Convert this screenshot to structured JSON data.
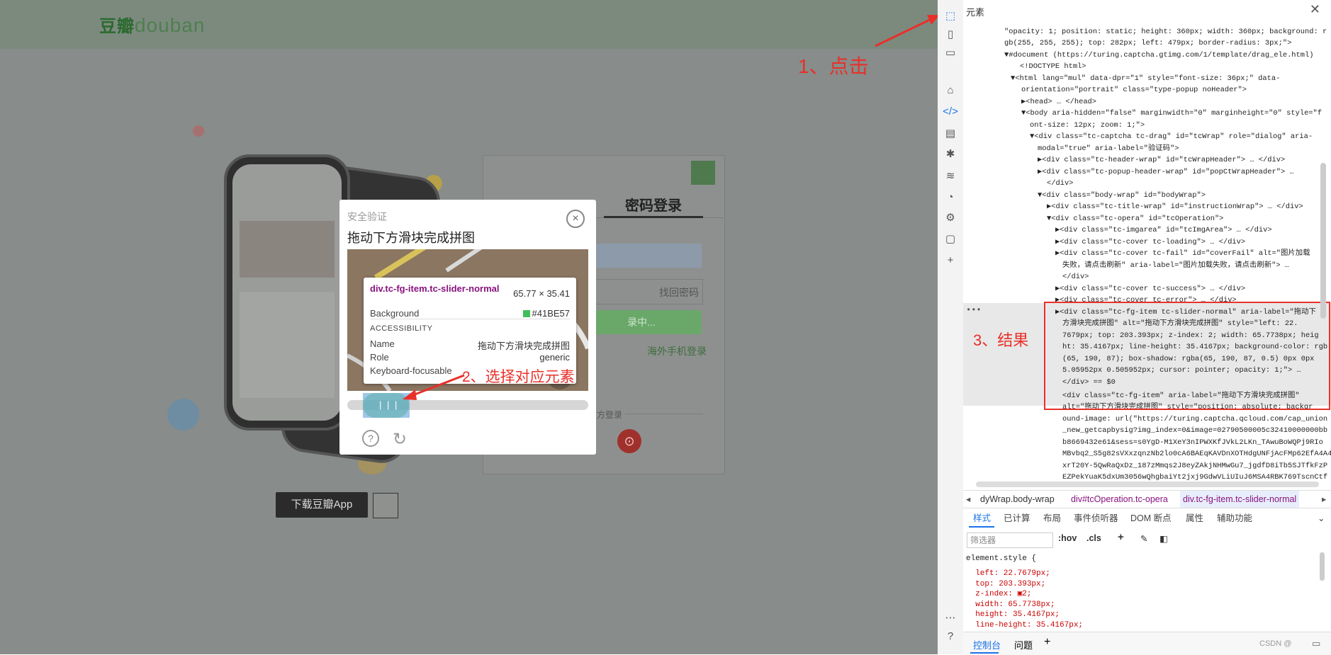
{
  "site": {
    "logo_cn": "豆瓣",
    "logo_en": "douban"
  },
  "login": {
    "tab_password": "密码登录",
    "forgot": "找回密码",
    "login_button": "录中...",
    "overseas": "海外手机登录",
    "third_party": "方登录",
    "download_app": "下载豆瓣App"
  },
  "captcha": {
    "title": "安全验证",
    "instruction": "拖动下方滑块完成拼图",
    "grip": "| | |"
  },
  "tooltip": {
    "selector": "div.tc-fg-item.tc-slider-normal",
    "size": "65.77 × 35.41",
    "background_label": "Background",
    "background_value": "#41BE57",
    "accessibility_heading": "ACCESSIBILITY",
    "name_label": "Name",
    "name_value": "拖动下方滑块完成拼图",
    "role_label": "Role",
    "role_value": "generic",
    "focusable_label": "Keyboard-focusable"
  },
  "annotations": {
    "step1": "1、点击",
    "step2": "2、选择对应元素",
    "step3": "3、结果"
  },
  "devtools": {
    "panel_title": "元素",
    "dom_lines": [
      "\"opacity: 1; position: static; height: 360px; width: 360px; background: r",
      "gb(255, 255, 255); top: 282px; left: 479px; border-radius: 3px;\">",
      "▼#document (https://turing.captcha.gtimg.com/1/template/drag_ele.html)",
      "<!DOCTYPE html>",
      "▼<html lang=\"mul\" data-dpr=\"1\" style=\"font-size: 36px;\" data-",
      "orientation=\"portrait\" class=\"type-popup noHeader\">",
      "▶<head> … </head>",
      "▼<body aria-hidden=\"false\" marginwidth=\"0\" marginheight=\"0\" style=\"f",
      "ont-size: 12px; zoom: 1;\">",
      "▼<div class=\"tc-captcha tc-drag\" id=\"tcWrap\" role=\"dialog\" aria-",
      "modal=\"true\" aria-label=\"验证码\">",
      "▶<div class=\"tc-header-wrap\" id=\"tcWrapHeader\"> … </div>",
      "▶<div class=\"tc-popup-header-wrap\" id=\"popCtWrapHeader\"> …",
      "</div>",
      "▼<div class=\"body-wrap\" id=\"bodyWrap\">",
      "▶<div class=\"tc-title-wrap\" id=\"instructionWrap\"> … </div>",
      "▼<div class=\"tc-opera\" id=\"tcOperation\">",
      "▶<div class=\"tc-imgarea\" id=\"tcImgArea\"> … </div>",
      "▶<div class=\"tc-cover tc-loading\"> … </div>",
      "▶<div class=\"tc-cover tc-fail\" id=\"coverFail\" alt=\"图片加载",
      "失败，请点击刷新\" aria-label=\"图片加载失败，请点击刷新\"> …",
      "</div>",
      "▶<div class=\"tc-cover tc-success\"> … </div>",
      "▶<div class=\"tc-cover tc-error\"> … </div>",
      "▶<div class=\"tc-fg-item tc-slider-normal\" aria-label=\"拖动下",
      "方滑块完成拼图\" alt=\"拖动下方滑块完成拼图\" style=\"left: 22.",
      "7679px; top: 203.393px; z-index: 2; width: 65.7738px; heig",
      "ht: 35.4167px; line-height: 35.4167px; background-color: rgb",
      "(65, 190, 87); box-shadow: rgba(65, 190, 87, 0.5) 0px 0px",
      "5.05952px 0.505952px; cursor: pointer; opacity: 1;\"> …",
      "</div> == $0",
      "<div class=\"tc-fg-item\" aria-label=\"拖动下方滑块完成拼图\"",
      "alt=\"拖动下方滑块完成拼图\" style=\"position: absolute; backgr",
      "ound-image: url(\"https://turing.captcha.qcloud.com/cap_union",
      "_new_getcapbysig?img_index=0&image=02790500005c32410000000bb",
      "b8669432e61&sess=s0YgD-M1XeY3nIPWXKfJVkL2LKn_TAwuBoWQPj9RIo",
      "MBvbq2_S5g82sVXxzqnzNb2lo0cA6BAEqKAVDnXOTHdgUNFjAcFMp62EfA4A4",
      "xrT20Y-5QwRaQxDz_187zMmqs2J8eyZAkjNHMwGu7_jgdfD8iTb5SJTfkFzP",
      "EZPekYuaK5dxUm3056wQhgbaiYt2jxj9GdwVLiUIuJ6MSA4RBK769TscnCtf"
    ],
    "breadcrumbs": [
      "dyWrap.body-wrap",
      "div#tcOperation.tc-opera",
      "div.tc-fg-item.tc-slider-normal"
    ],
    "bottom_tabs": [
      "样式",
      "已计算",
      "布局",
      "事件侦听器",
      "DOM 断点",
      "属性",
      "辅助功能"
    ],
    "filter_placeholder": "筛选器",
    "hov": ":hov",
    "cls": ".cls",
    "style_lines": [
      "element.style {",
      "  left: 22.7679px;",
      "  top: 203.393px;",
      "  z-index: ▣2;",
      "  width: 65.7738px;",
      "  height: 35.4167px;",
      "  line-height: 35.4167px;"
    ],
    "console_tab": "控制台",
    "issues_tab": "问题",
    "watermark": "CSDN @"
  },
  "colors": {
    "accent": "#41BE57",
    "annotation": "#e8302a",
    "tag": "#881280"
  }
}
